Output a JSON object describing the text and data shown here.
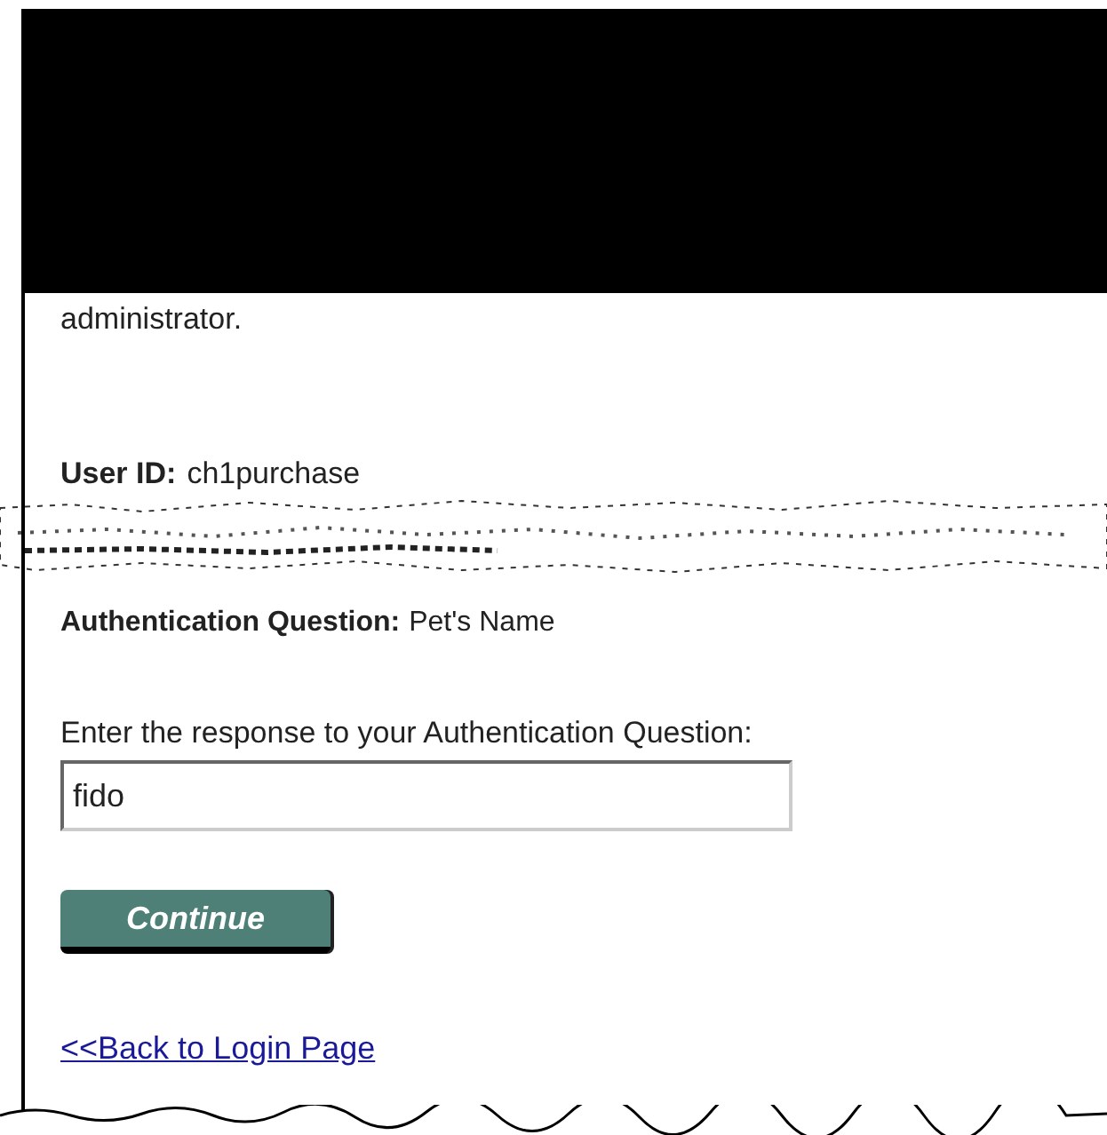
{
  "intro_tail": "administrator.",
  "user_id": {
    "label": "User ID:",
    "value": "ch1purchase"
  },
  "question": {
    "label": "Authentication Question:",
    "value": "Pet's Name"
  },
  "response": {
    "label": "Enter the response to your Authentication Question:",
    "value": "fido"
  },
  "continue_button": "Continue",
  "back_link": "<<Back to Login Page"
}
